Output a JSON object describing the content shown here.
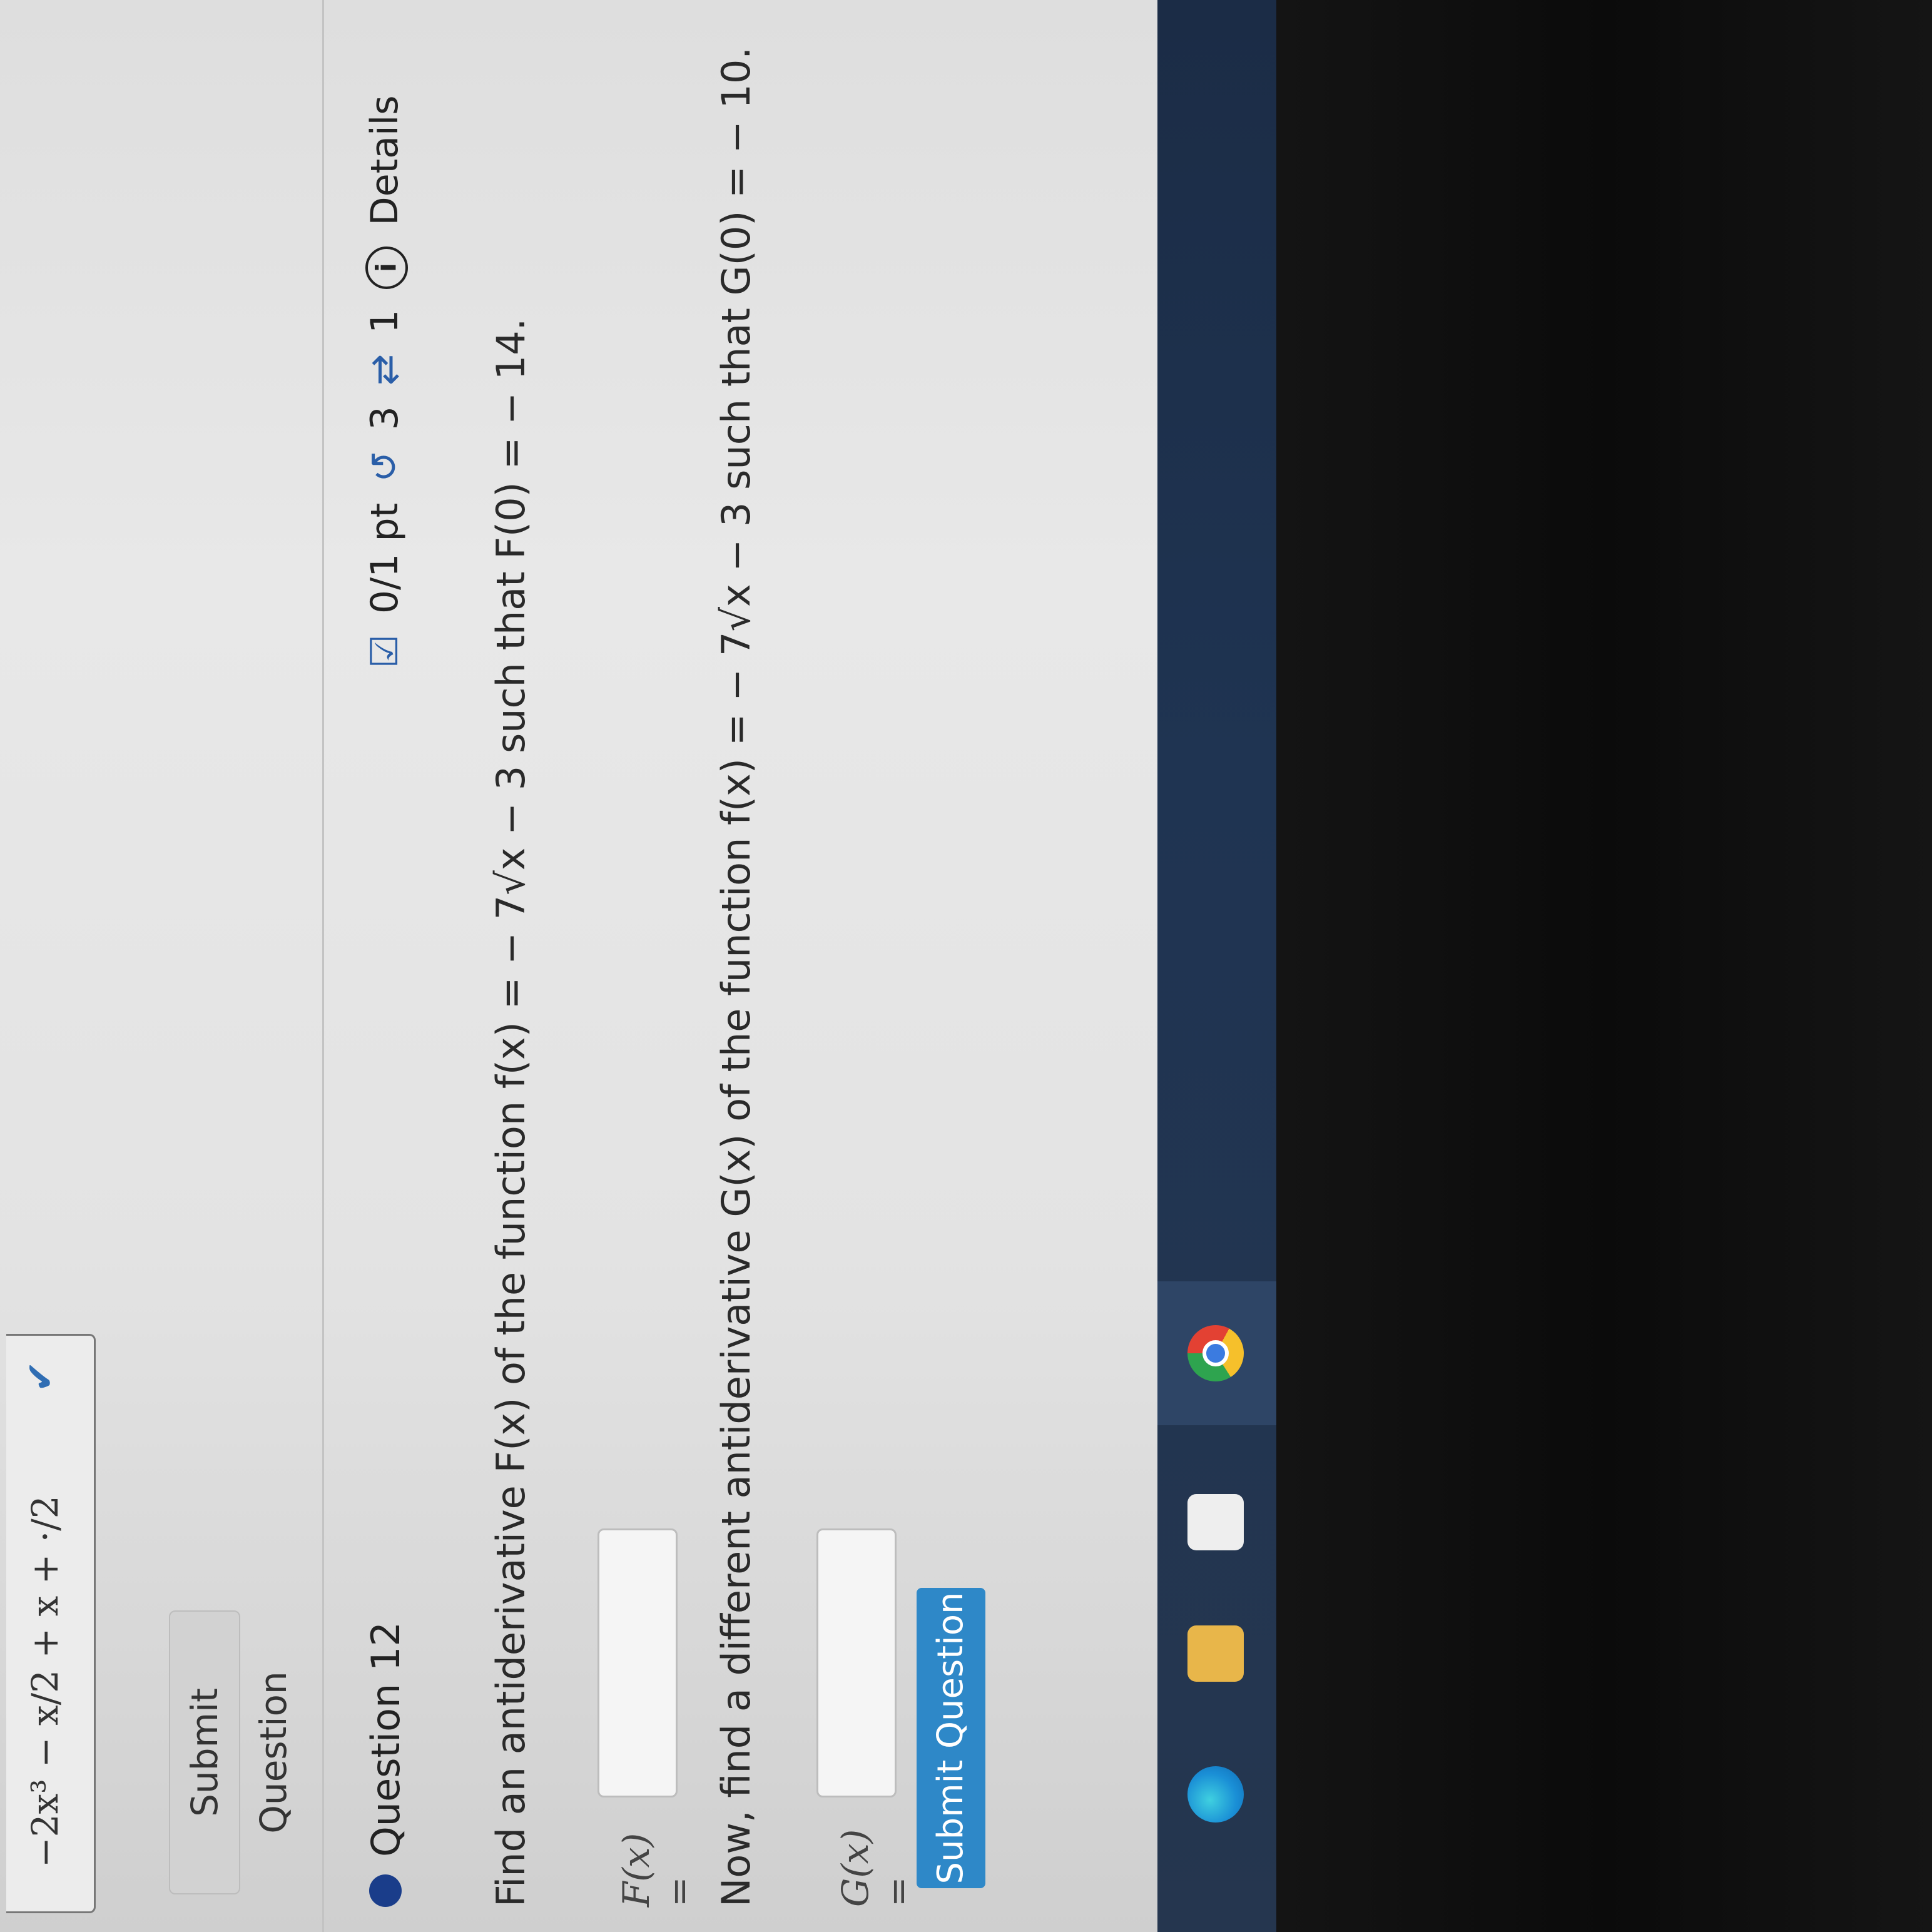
{
  "previous_answer": {
    "expression": "−2x³ − x/2 + x + ·/2"
  },
  "previous_submit_label": "Submit Question",
  "question": {
    "title": "Question 12",
    "score": "0/1 pt",
    "attempts": "3",
    "retries": "1",
    "details_label": "Details",
    "part1_prompt": "Find an antiderivative F(x) of the function f(x) = − 7√x − 3 such that F(0) = − 14.",
    "part1_label": "F(x) =",
    "part1_value": "",
    "part2_prompt": "Now, find a different antiderivative G(x) of the function f(x) = − 7√x − 3 such that G(0) = − 10.",
    "part2_label": "G(x) =",
    "part2_value": "",
    "submit_label": "Submit Question"
  },
  "colors": {
    "submit_blue": "#2e88c8",
    "bullet_navy": "#1a3d8a",
    "taskbar": "#1f3452"
  },
  "taskbar_icons": [
    "edge-icon",
    "file-explorer-icon",
    "store-icon",
    "chrome-icon"
  ]
}
